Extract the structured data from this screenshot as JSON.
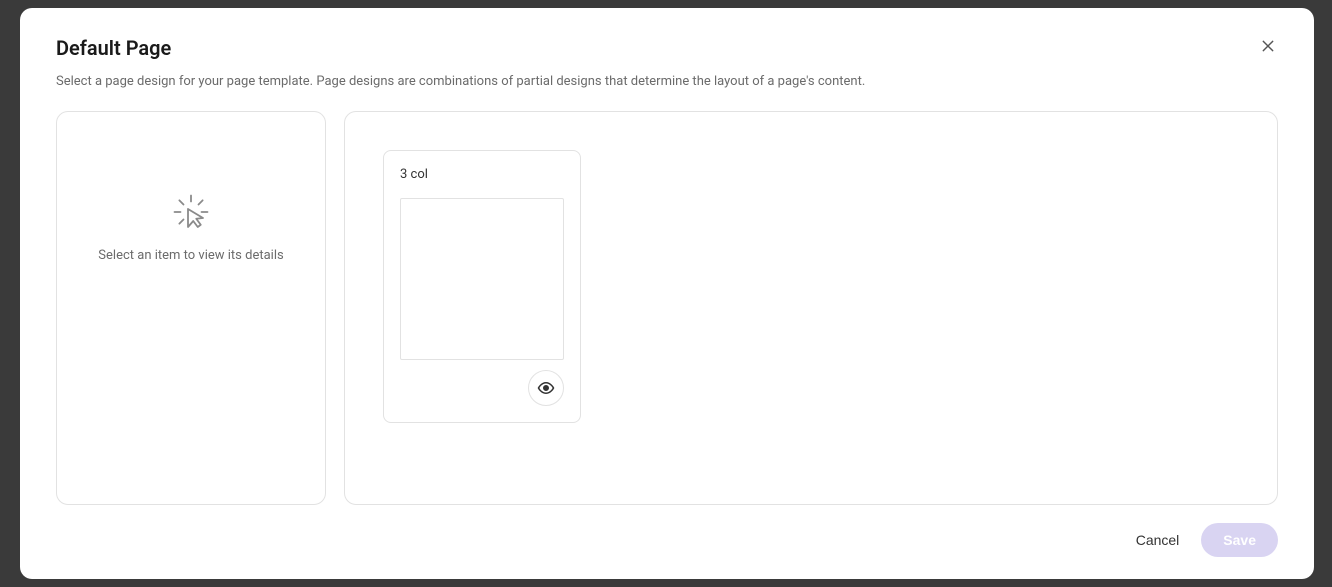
{
  "modal": {
    "title": "Default Page",
    "description": "Select a page design for your page template. Page designs are combinations of partial designs that determine the layout of a page's content."
  },
  "details_panel": {
    "placeholder": "Select an item to view its details"
  },
  "designs": [
    {
      "name": "3 col"
    }
  ],
  "footer": {
    "cancel": "Cancel",
    "save": "Save"
  }
}
